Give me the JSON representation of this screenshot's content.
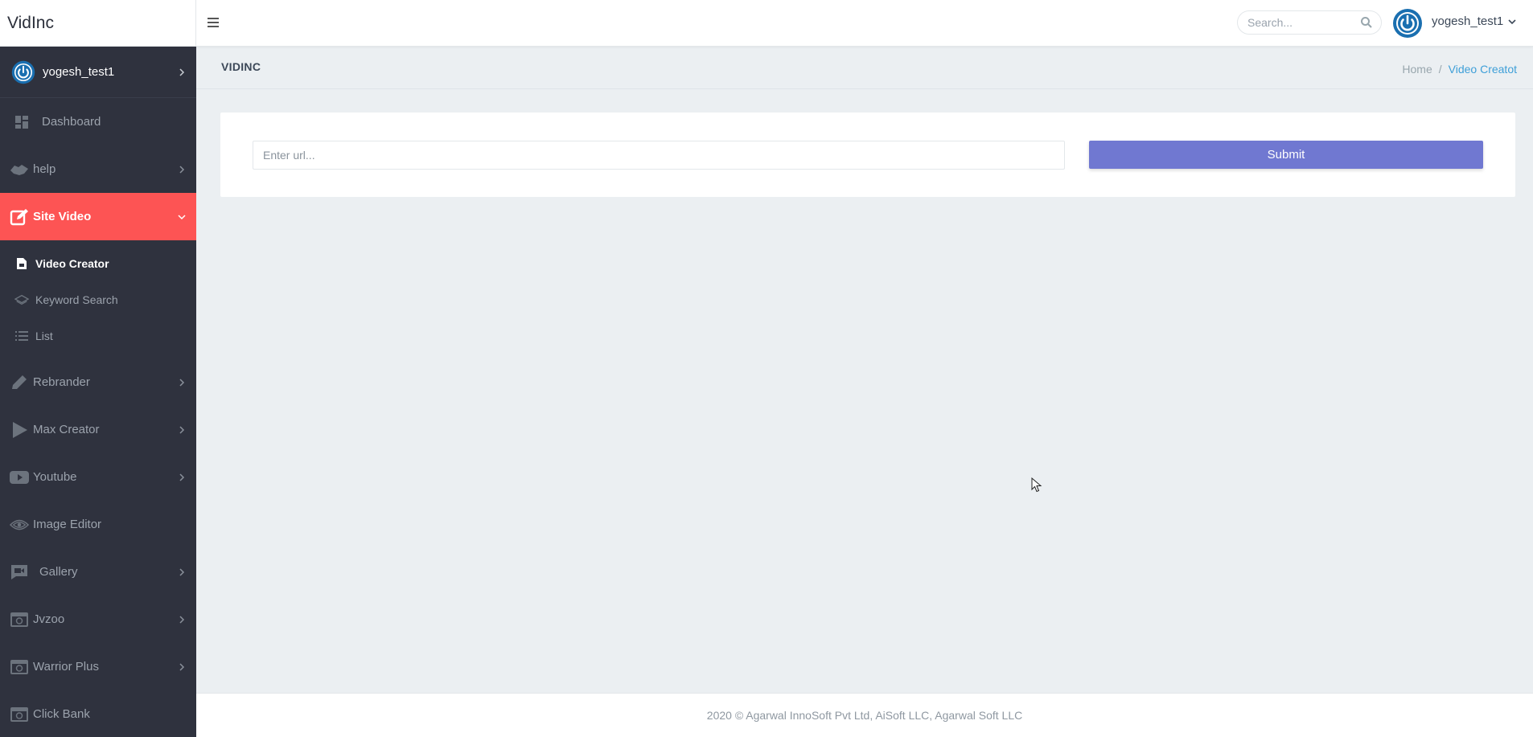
{
  "header": {
    "brand": "VidInc",
    "search_placeholder": "Search...",
    "username": "yogesh_test1"
  },
  "sidebar": {
    "profile_name": "yogesh_test1",
    "items": [
      {
        "label": "Dashboard",
        "icon": "dashboard-icon"
      },
      {
        "label": "help",
        "icon": "handshake-icon"
      },
      {
        "label": "Site Video",
        "icon": "edit-icon",
        "active": true
      },
      {
        "label": "Rebrander",
        "icon": "pencil-icon"
      },
      {
        "label": "Max Creator",
        "icon": "play-icon"
      },
      {
        "label": "Youtube",
        "icon": "youtube-icon"
      },
      {
        "label": "Image Editor",
        "icon": "eye-icon"
      },
      {
        "label": "Gallery",
        "icon": "video-chat-icon"
      },
      {
        "label": "Jvzoo",
        "icon": "camera-icon"
      },
      {
        "label": "Warrior Plus",
        "icon": "camera-icon"
      },
      {
        "label": "Click Bank",
        "icon": "camera-icon"
      }
    ],
    "subitems": [
      {
        "label": "Video Creator",
        "icon": "file-icon"
      },
      {
        "label": "Keyword Search",
        "icon": "layers-icon"
      },
      {
        "label": "List",
        "icon": "list-icon"
      }
    ]
  },
  "page": {
    "title": "VIDINC",
    "breadcrumb_home": "Home",
    "breadcrumb_separator": "/",
    "breadcrumb_current": "Video Creatot"
  },
  "form": {
    "url_placeholder": "Enter url...",
    "url_value": "",
    "submit_label": "Submit"
  },
  "footer": {
    "text": "2020 © Agarwal InnoSoft Pvt Ltd, AiSoft LLC, Agarwal Soft LLC"
  },
  "colors": {
    "sidebar_bg": "#2f323e",
    "active_item": "#fd5454",
    "submit_button": "#7078d1",
    "breadcrumb_active": "#3e9fd8",
    "content_bg": "#ebeff2"
  }
}
